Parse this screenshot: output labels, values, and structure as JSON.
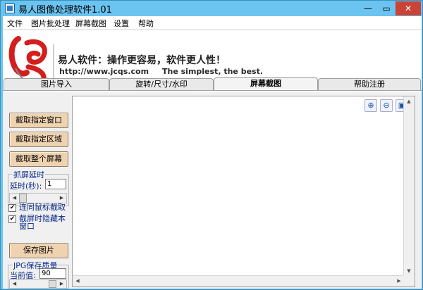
{
  "window": {
    "title": "易人图像处理软件1.01",
    "controls": {
      "minimize": "—",
      "maximize": "▭",
      "close": "✕"
    }
  },
  "menu": [
    "文件",
    "图片批处理",
    "屏幕截图",
    "设置",
    "帮助"
  ],
  "banner": {
    "slogan": "易人软件：操作更容易，软件更人性！",
    "url": "http://www.jcqs.com",
    "tagline": "The simplest, the best."
  },
  "tabs": [
    {
      "label": "图片导入",
      "active": false
    },
    {
      "label": "旋转/尺寸/水印",
      "active": false
    },
    {
      "label": "屏幕截图",
      "active": true
    },
    {
      "label": "帮助注册",
      "active": false
    }
  ],
  "actions": {
    "capture_window": "截取指定窗口",
    "capture_region": "截取指定区域",
    "capture_screen": "截取整个屏幕",
    "save_image": "保存图片"
  },
  "delay": {
    "group_title": "抓屏延时",
    "label": "延时(秒):",
    "value": "1",
    "slider_fraction": 0.05
  },
  "options": [
    {
      "label": "连同鼠标截取",
      "checked": true
    },
    {
      "label": "截屏时隐藏本窗口",
      "checked": true
    }
  ],
  "jpg_quality": {
    "group_title": "JPG保存质量",
    "label": "当前值:",
    "value": "90",
    "slider_fraction": 0.9
  },
  "canvas_tools": [
    "zoom-in-icon",
    "zoom-out-icon",
    "fit-window-icon"
  ],
  "colors": {
    "title_bar": "#6bc3f0",
    "close_button": "#c94336",
    "action_button": "#efd3b1",
    "group_text": "#0a2a8a"
  }
}
